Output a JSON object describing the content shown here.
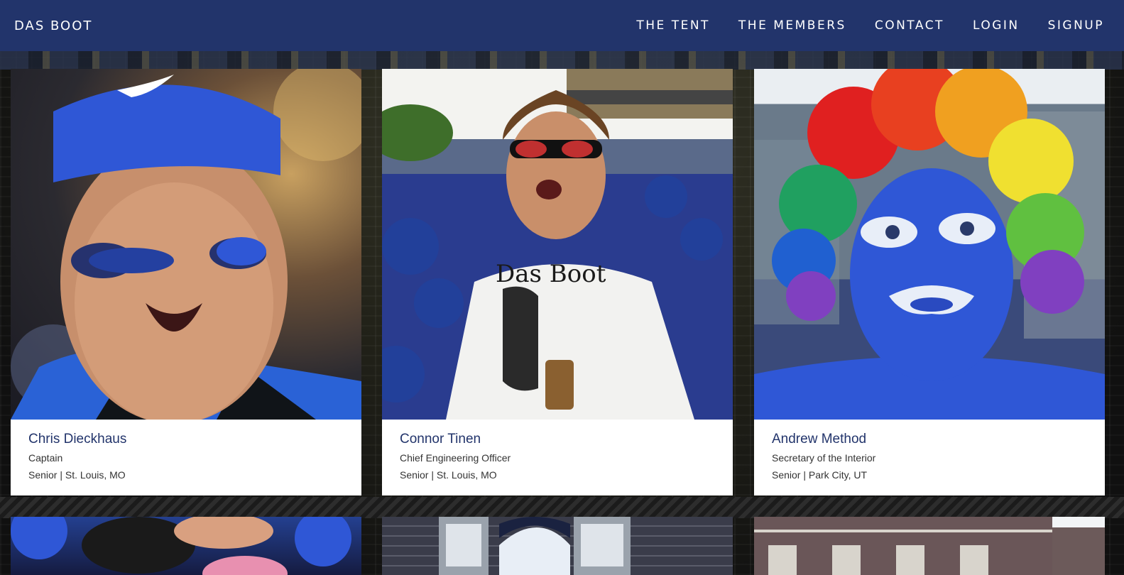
{
  "nav": {
    "brand": "DAS BOOT",
    "links": [
      "THE TENT",
      "THE MEMBERS",
      "CONTACT",
      "LOGIN",
      "SIGNUP"
    ]
  },
  "members": [
    {
      "name": "Chris Dieckhaus",
      "role": "Captain",
      "meta": "Senior | St. Louis, MO"
    },
    {
      "name": "Connor Tinen",
      "role": "Chief Engineering Officer",
      "meta": "Senior | St. Louis, MO"
    },
    {
      "name": "Andrew Method",
      "role": "Secretary of the Interior",
      "meta": "Senior | Park City, UT"
    }
  ],
  "shirt_text": "Das Boot",
  "colors": {
    "navbar": "#22346b",
    "name": "#22346b",
    "accent_blue": "#2f57d6"
  }
}
